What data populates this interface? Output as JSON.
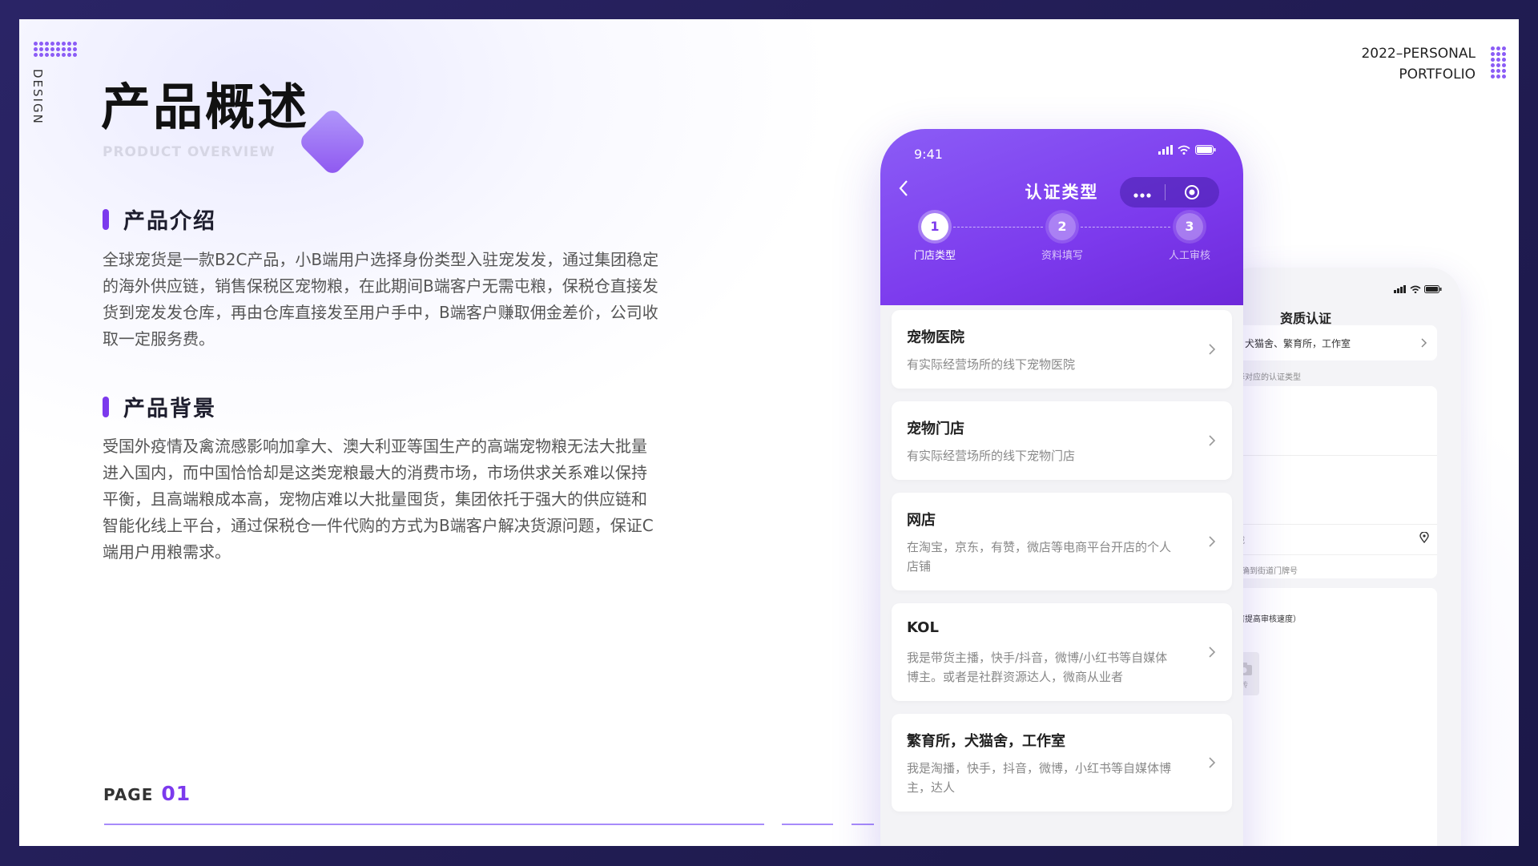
{
  "slide": {
    "design_label": "DESIGN",
    "portfolio_line1": "2022–PERSONAL",
    "portfolio_line2": "PORTFOLIO",
    "title": "产品概述",
    "subtitle": "PRODUCT OVERVIEW",
    "sections": [
      {
        "heading": "产品介绍",
        "body": "全球宠货是一款B2C产品，小B端用户选择身份类型入驻宠发发，通过集团稳定的海外供应链，销售保税区宠物粮，在此期间B端客户无需屯粮，保税仓直接发货到宠发发仓库，再由仓库直接发至用户手中，B端客户赚取佣金差价，公司收取一定服务费。"
      },
      {
        "heading": "产品背景",
        "body": "受国外疫情及禽流感影响加拿大、澳大利亚等国生产的高端宠物粮无法大批量进入国内，而中国恰恰却是这类宠粮最大的消费市场，市场供求关系难以保持平衡，且高端粮成本高，宠物店难以大批量囤货，集团依托于强大的供应链和智能化线上平台，通过保税仓一件代购的方式为B端客户解决货源问题，保证C端用户用粮需求。"
      }
    ],
    "page_label": "PAGE",
    "page_number": "01",
    "accent": "#7c3aed"
  },
  "phone": {
    "time": "9:41",
    "title": "认证类型",
    "steps": [
      {
        "num": "1",
        "label": "门店类型"
      },
      {
        "num": "2",
        "label": "资料填写"
      },
      {
        "num": "3",
        "label": "人工审核"
      }
    ],
    "options": [
      {
        "title": "宠物医院",
        "desc": "有实际经营场所的线下宠物医院"
      },
      {
        "title": "宠物门店",
        "desc": "有实际经营场所的线下宠物门店"
      },
      {
        "title": "网店",
        "desc": "在淘宝，京东，有赞，微店等电商平台开店的个人店铺"
      },
      {
        "title": "KOL",
        "desc": "我是带货主播，快手/抖音，微博/小红书等自媒体博主。或者是社群资源达人，微商从业者"
      },
      {
        "title": "繁育所，犬猫舍，工作室",
        "desc": "我是淘播，快手，抖音，微博，小红书等自媒体博主，达人"
      }
    ]
  },
  "phone_back": {
    "title": "资质认证",
    "selected_type": "犬猫舍、繁育所，工作室",
    "hint": "况选择对应的认证类型",
    "region_label": "区域",
    "address_placeholder": "精确到街道门牌号",
    "upload_hint": "显著提高审核速度）",
    "upload_label": "上传"
  }
}
